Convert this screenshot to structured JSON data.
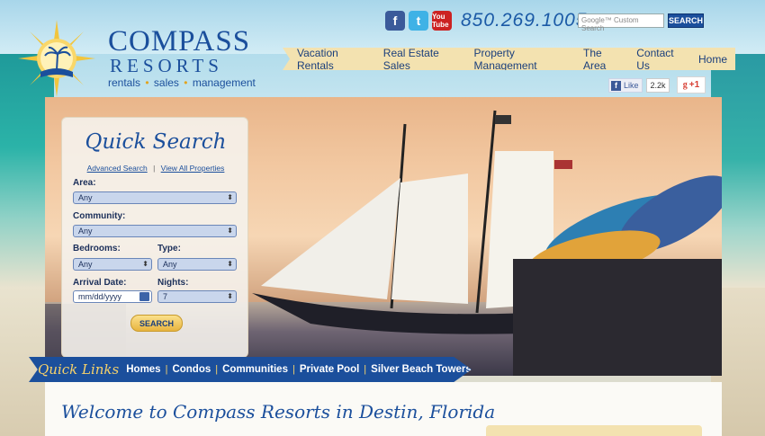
{
  "brand": {
    "name": "COMPASS",
    "sub": "RESORTS",
    "tagline": [
      "rentals",
      "sales",
      "management"
    ]
  },
  "header": {
    "social": {
      "fb": "f",
      "tw": "t",
      "yt": "You Tube"
    },
    "phone": "850.269.1005",
    "search": {
      "placeholder": "Google™ Custom Search",
      "button": "SEARCH"
    },
    "nav": [
      "Vacation Rentals",
      "Real Estate Sales",
      "Property Management",
      "The Area",
      "Contact Us",
      "Home"
    ],
    "fb_like": "Like",
    "fb_count": "2.2k",
    "gplus": "+1"
  },
  "quick_search": {
    "title": "Quick Search",
    "advanced_link": "Advanced Search",
    "view_all_link": "View All Properties",
    "area_label": "Area:",
    "area_value": "Any",
    "community_label": "Community:",
    "community_value": "Any",
    "bedrooms_label": "Bedrooms:",
    "bedrooms_value": "Any",
    "type_label": "Type:",
    "type_value": "Any",
    "arrival_label": "Arrival Date:",
    "arrival_placeholder": "mm/dd/yyyy",
    "nights_label": "Nights:",
    "nights_value": "7",
    "button": "SEARCH"
  },
  "quick_links": {
    "title": "Quick Links",
    "items": [
      "Homes",
      "Condos",
      "Communities",
      "Private Pool",
      "Silver Beach Towers"
    ]
  },
  "content": {
    "welcome": "Welcome to Compass Resorts in Destin, Florida"
  },
  "colors": {
    "brand_blue": "#1b4f9c",
    "gold": "#f3e2b0",
    "accent_gold": "#e8b43f"
  }
}
